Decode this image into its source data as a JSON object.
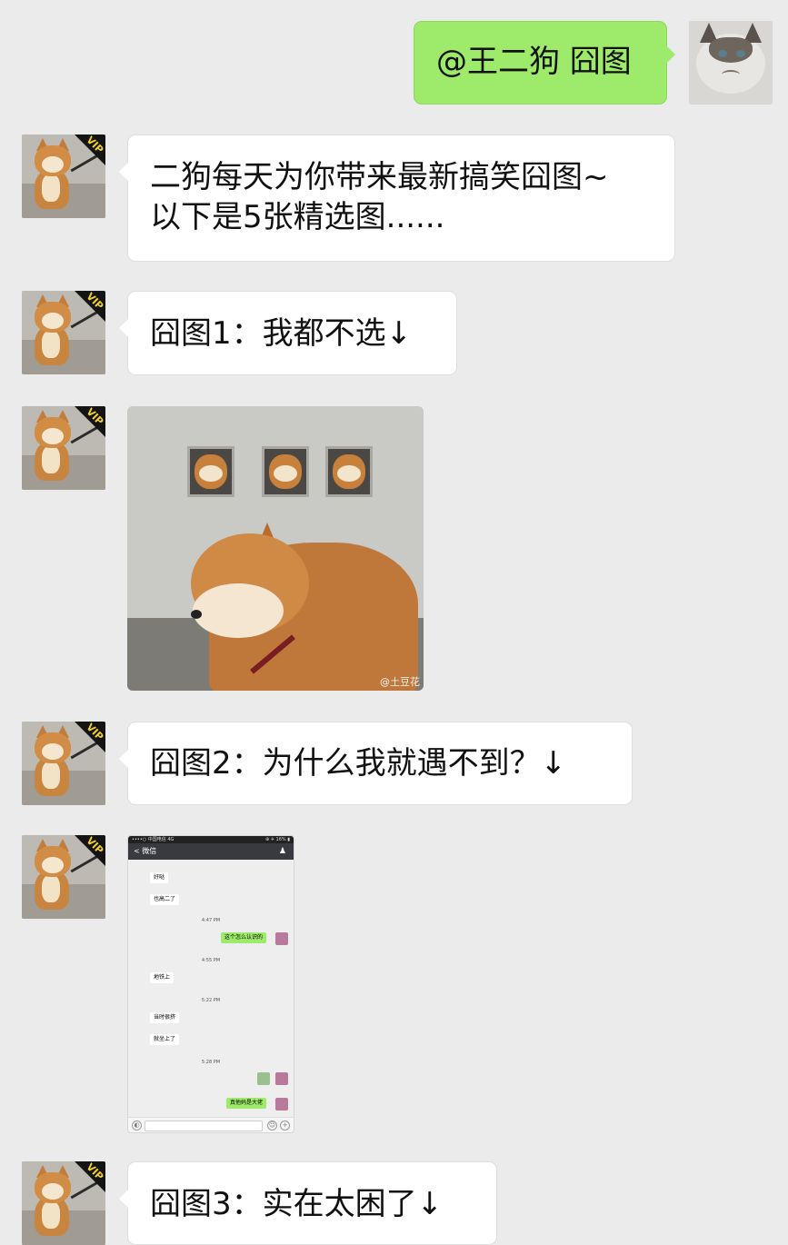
{
  "messages": [
    {
      "id": "m1",
      "side": "right",
      "text": "@王二狗 囧图"
    },
    {
      "id": "m2",
      "side": "left",
      "line1": "二狗每天为你带来最新搞笑囧图~",
      "line2": "以下是5张精选图......"
    },
    {
      "id": "m3",
      "side": "left",
      "text": "囧图1：我都不选↓"
    },
    {
      "id": "m4",
      "side": "left",
      "type": "image",
      "subject": "shiba-dogs-in-wall-photo",
      "watermark": "@土豆花"
    },
    {
      "id": "m5",
      "side": "left",
      "text": "囧图2：为什么我就遇不到？↓"
    },
    {
      "id": "m6",
      "side": "left",
      "type": "image",
      "subject": "chat-screenshot"
    },
    {
      "id": "m7",
      "side": "left",
      "text": "囧图3：实在太困了↓"
    }
  ],
  "shot": {
    "status_carrier": "••••○ 中国电信  4G",
    "status_right": "⊕ ✈ 16% ▮",
    "back": "< 微信",
    "items": [
      {
        "kind": "in",
        "text": "好哒"
      },
      {
        "kind": "in",
        "text": "也高二了"
      },
      {
        "kind": "time",
        "text": "4:47 PM"
      },
      {
        "kind": "out",
        "text": "这个怎么认识的"
      },
      {
        "kind": "time",
        "text": "4:55 PM"
      },
      {
        "kind": "in",
        "text": "地铁上"
      },
      {
        "kind": "time",
        "text": "5:22 PM"
      },
      {
        "kind": "in",
        "text": "当时很挤"
      },
      {
        "kind": "in",
        "text": "就坐上了"
      },
      {
        "kind": "time",
        "text": "5:28 PM"
      },
      {
        "kind": "out",
        "text": "真他妈是大佬"
      }
    ]
  },
  "vip_label": "VIP"
}
